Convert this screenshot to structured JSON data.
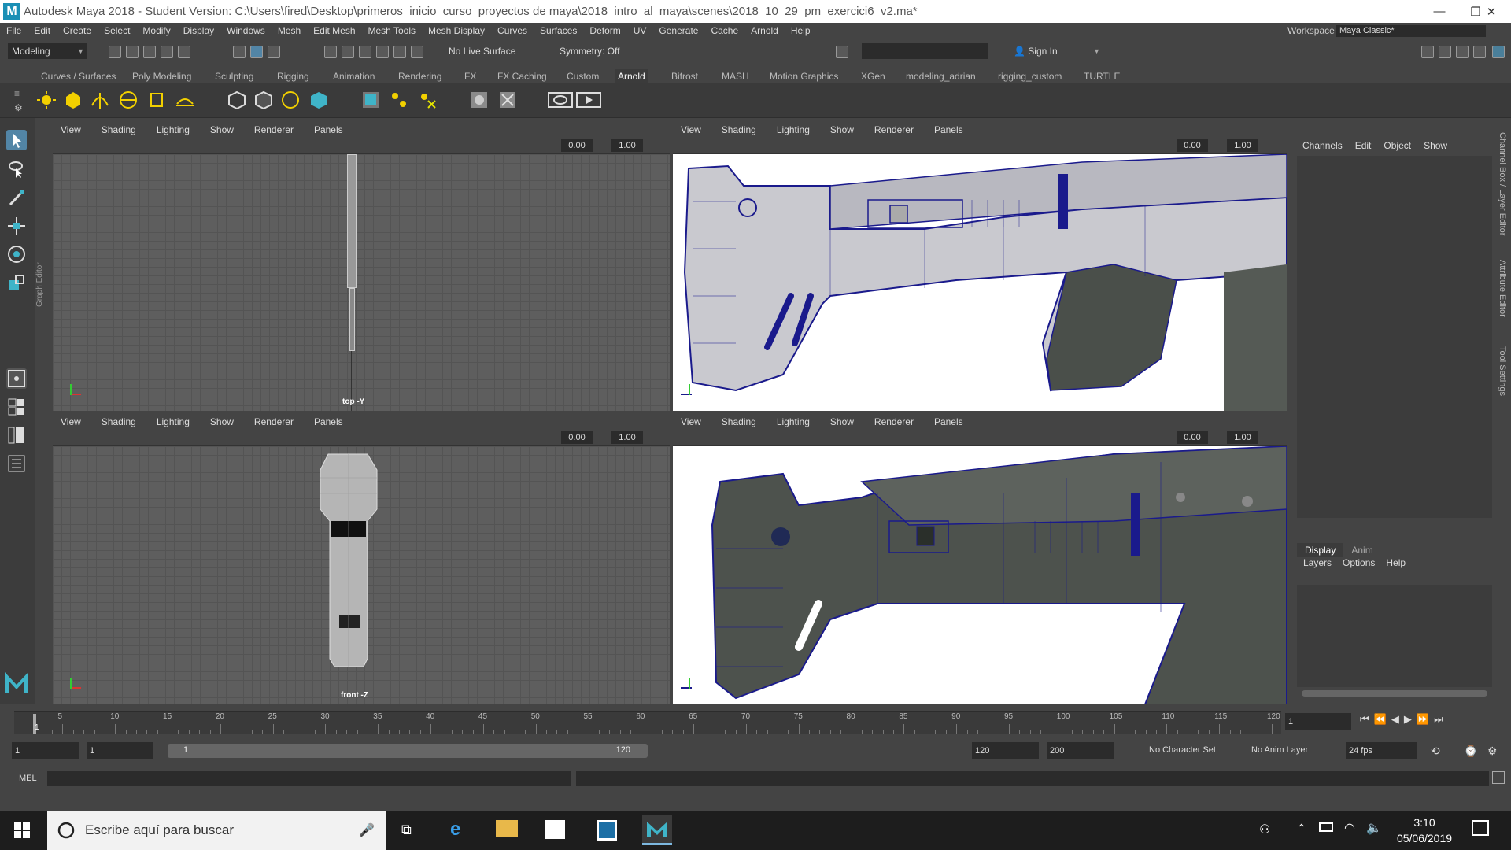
{
  "window": {
    "app_logo_letter": "M",
    "title": "Autodesk Maya 2018 - Student Version: C:\\Users\\fired\\Desktop\\primeros_inicio_curso_proyectos de maya\\2018_intro_al_maya\\scenes\\2018_10_29_pm_exercici6_v2.ma*",
    "minimize": "—",
    "maximize": "❐",
    "close": "✕"
  },
  "menubar": {
    "items": [
      "File",
      "Edit",
      "Create",
      "Select",
      "Modify",
      "Display",
      "Windows",
      "Mesh",
      "Edit Mesh",
      "Mesh Tools",
      "Mesh Display",
      "Curves",
      "Surfaces",
      "Deform",
      "UV",
      "Generate",
      "Cache",
      "Arnold",
      "Help"
    ],
    "workspace_label": "Workspace :",
    "workspace_value": "Maya Classic*"
  },
  "statusline": {
    "menuset": "Modeling",
    "live_surface": "No Live Surface",
    "symmetry": "Symmetry: Off",
    "sign_in": "Sign In"
  },
  "shelf": {
    "tabs": [
      "Curves / Surfaces",
      "Poly Modeling",
      "Sculpting",
      "Rigging",
      "Animation",
      "Rendering",
      "FX",
      "FX Caching",
      "Custom",
      "Arnold",
      "Bifrost",
      "MASH",
      "Motion Graphics",
      "XGen",
      "modeling_adrian",
      "rigging_custom",
      "TURTLE"
    ],
    "active_tab": "Arnold"
  },
  "toolbox": {
    "graph_editor_label": "Graph Editor"
  },
  "viewports": {
    "menu": [
      "View",
      "Shading",
      "Lighting",
      "Show",
      "Renderer",
      "Panels"
    ],
    "field_a": "0.00",
    "field_b": "1.00",
    "top_label": "top -Y",
    "front_label": "front -Z"
  },
  "channelbox": {
    "menu": [
      "Channels",
      "Edit",
      "Object",
      "Show"
    ],
    "layer_tabs": [
      "Display",
      "Anim"
    ],
    "layer_menu": [
      "Layers",
      "Options",
      "Help"
    ],
    "side_tabs": [
      "Channel Box / Layer Editor",
      "Attribute Editor",
      "Tool Settings"
    ]
  },
  "timeline": {
    "ticks": [
      "5",
      "10",
      "15",
      "20",
      "25",
      "30",
      "35",
      "40",
      "45",
      "50",
      "55",
      "60",
      "65",
      "70",
      "75",
      "80",
      "85",
      "90",
      "95",
      "100",
      "105",
      "110",
      "115",
      "120"
    ],
    "current_frame_marker": "1",
    "current_frame": "1"
  },
  "range": {
    "start": "1",
    "playback_start": "1",
    "slider_start": "1",
    "slider_end": "120",
    "playback_end": "120",
    "end": "200",
    "character_set": "No Character Set",
    "anim_layer": "No Anim Layer",
    "fps": "24 fps"
  },
  "mel": {
    "label": "MEL"
  },
  "taskbar": {
    "search_placeholder": "Escribe aquí para buscar",
    "time": "3:10",
    "date": "05/06/2019"
  },
  "colors": {
    "accent": "#1a8fb5",
    "wire": "#1a1a8c",
    "viewport_bg": "#5e5e5e"
  }
}
